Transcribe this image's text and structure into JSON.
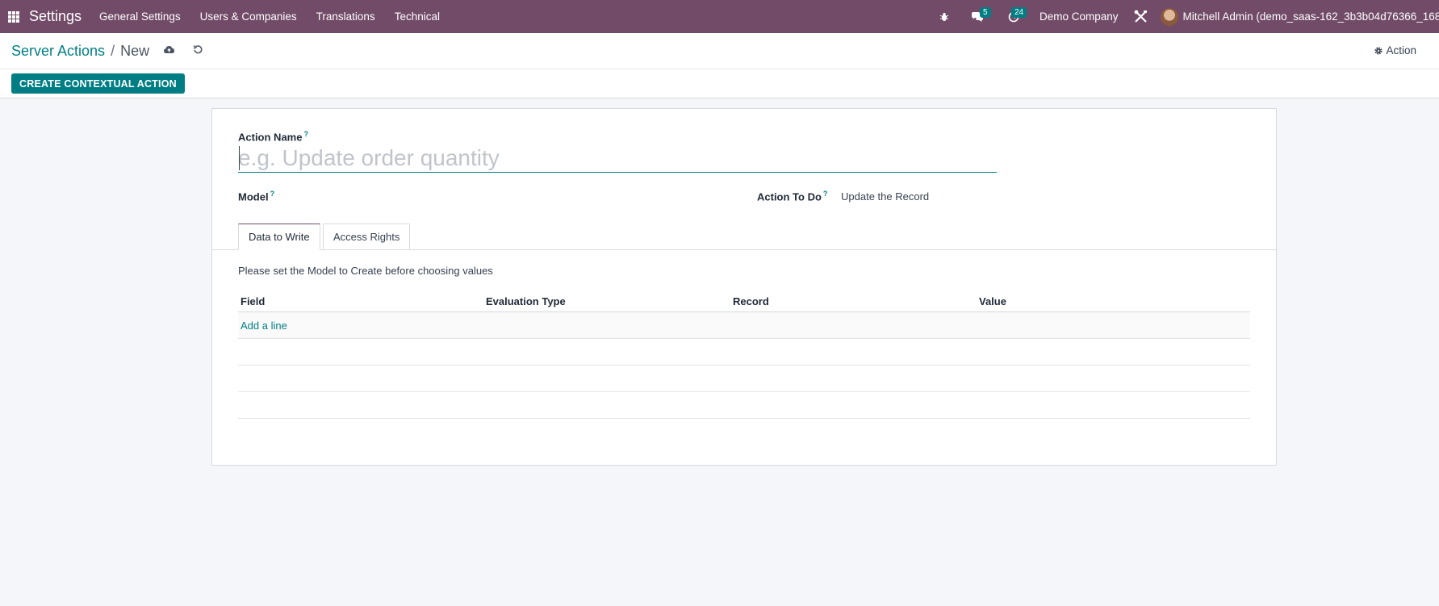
{
  "navbar": {
    "brand": "Settings",
    "menu": [
      "General Settings",
      "Users & Companies",
      "Translations",
      "Technical"
    ],
    "messages_count": "5",
    "activities_count": "24",
    "company": "Demo Company",
    "user": "Mitchell Admin (demo_saas-162_3b3b04d76366_168"
  },
  "breadcrumb": {
    "parent": "Server Actions",
    "separator": "/",
    "current": "New"
  },
  "control_panel": {
    "action_label": "Action",
    "create_contextual_action": "CREATE CONTEXTUAL ACTION"
  },
  "form": {
    "action_name_label": "Action Name",
    "help_mark": "?",
    "action_name_placeholder": "e.g. Update order quantity",
    "model_label": "Model",
    "action_to_do_label": "Action To Do",
    "action_to_do_value": "Update the Record",
    "tabs": [
      "Data to Write",
      "Access Rights"
    ],
    "notice": "Please set the Model to Create before choosing values",
    "columns": [
      "Field",
      "Evaluation Type",
      "Record",
      "Value"
    ],
    "add_line": "Add a line"
  },
  "colors": {
    "brand": "#714b67",
    "accent": "#017e84"
  }
}
